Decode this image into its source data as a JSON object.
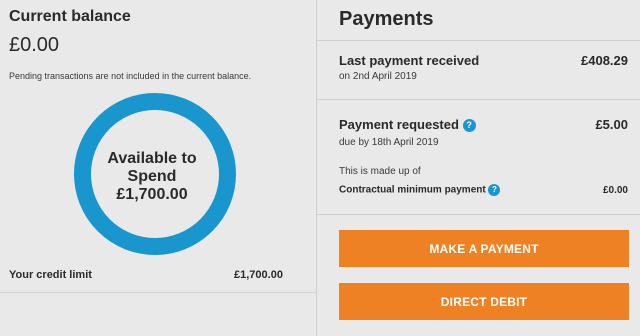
{
  "balance": {
    "title": "Current balance",
    "amount": "£0.00",
    "note": "Pending transactions are not included in the current balance."
  },
  "available": {
    "line1": "Available to",
    "line2": "Spend",
    "amount": "£1,700.00",
    "ring_color": "#1a96cf"
  },
  "credit_limit": {
    "label": "Your credit limit",
    "value": "£1,700.00"
  },
  "payments": {
    "title": "Payments",
    "last_payment": {
      "label": "Last payment received",
      "date": "on 2nd April 2019",
      "value": "£408.29"
    },
    "requested": {
      "label": "Payment requested",
      "due": "due by 18th April 2019",
      "value": "£5.00",
      "made_up_of": "This is made up of",
      "min_label": "Contractual minimum payment",
      "min_value": "£0.00"
    },
    "help_icon": "?",
    "buttons": {
      "make_payment": "MAKE A PAYMENT",
      "direct_debit": "DIRECT DEBIT"
    },
    "accent_color": "#ee8123"
  }
}
